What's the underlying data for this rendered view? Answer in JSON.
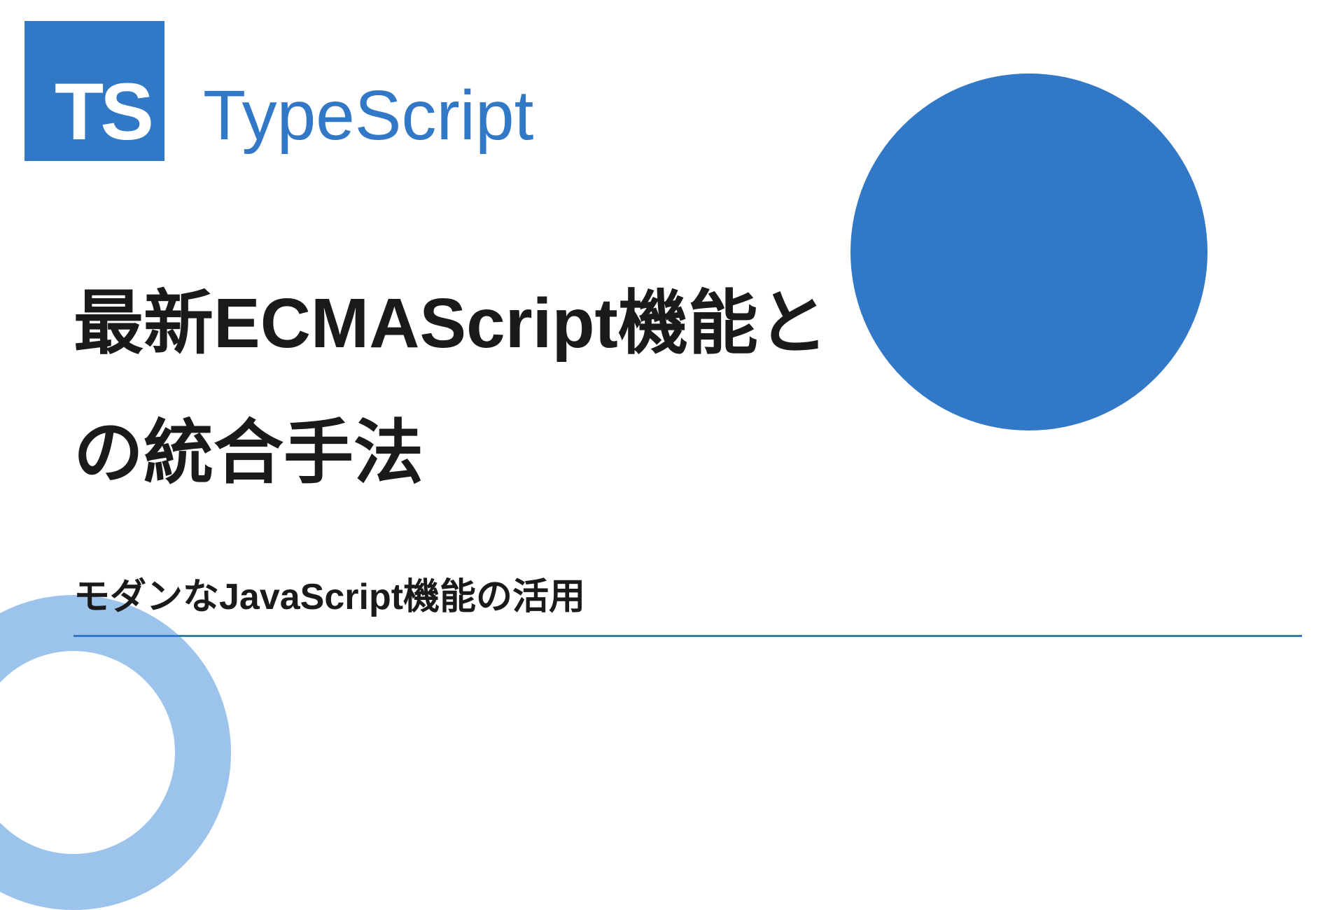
{
  "logo": {
    "badge_text": "TS",
    "brand_name": "TypeScript"
  },
  "content": {
    "main_title": "最新ECMAScript機能との統合手法",
    "subtitle": "モダンなJavaScript機能の活用"
  },
  "colors": {
    "primary": "#3178c6",
    "accent_light": "#8bb8e8",
    "text": "#1a1a1a"
  }
}
